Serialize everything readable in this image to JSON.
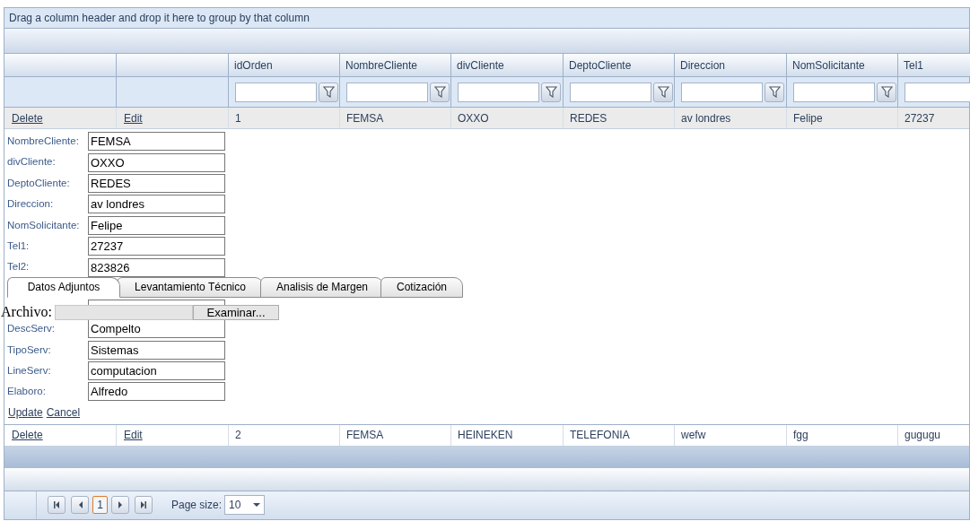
{
  "group_panel": {
    "text": "Drag a column header and drop it here to group by that column"
  },
  "columns": [
    "idOrden",
    "NombreCliente",
    "divCliente",
    "DeptoCliente",
    "Direccion",
    "NomSolicitante",
    "Tel1"
  ],
  "rows": [
    {
      "delete": "Delete",
      "edit": "Edit",
      "editing": true,
      "cells": [
        "1",
        "FEMSA",
        "OXXO",
        "REDES",
        "av londres",
        "Felipe",
        "27237"
      ]
    },
    {
      "delete": "Delete",
      "edit": "Edit",
      "editing": false,
      "cells": [
        "2",
        "FEMSA",
        "HEINEKEN",
        "TELEFONIA",
        "wefw",
        "fgg",
        "gugugu"
      ]
    }
  ],
  "edit_form": {
    "fields_above": [
      {
        "label": "NombreCliente:",
        "value": "FEMSA"
      },
      {
        "label": "divCliente:",
        "value": "OXXO"
      },
      {
        "label": "DeptoCliente:",
        "value": "REDES"
      },
      {
        "label": "Direccion:",
        "value": "av londres"
      },
      {
        "label": "NomSolicitante:",
        "value": "Felipe"
      },
      {
        "label": "Tel1:",
        "value": "27237"
      },
      {
        "label": "Tel2:",
        "value": "823826"
      }
    ],
    "tabs": [
      {
        "label": "Datos Adjuntos",
        "selected": true
      },
      {
        "label": "Levantamiento Técnico",
        "selected": false
      },
      {
        "label": "Analisis de Margen",
        "selected": false
      },
      {
        "label": "Cotización",
        "selected": false
      }
    ],
    "fields_below": [
      {
        "covered": true
      },
      {
        "label": "DescServ:",
        "value": "Compelto"
      },
      {
        "label": "TipoServ:",
        "value": "Sistemas"
      },
      {
        "label": "LineServ:",
        "value": "computacion"
      },
      {
        "label": "Elaboro:",
        "value": "Alfredo"
      }
    ],
    "upload": {
      "label": "Archivo:",
      "button": "Examinar..."
    },
    "actions": [
      "Update",
      "Cancel"
    ]
  },
  "pager": {
    "pages": [
      {
        "label": "1",
        "selected": true
      }
    ],
    "page_size": {
      "label": "Page size:",
      "value": "10"
    }
  }
}
